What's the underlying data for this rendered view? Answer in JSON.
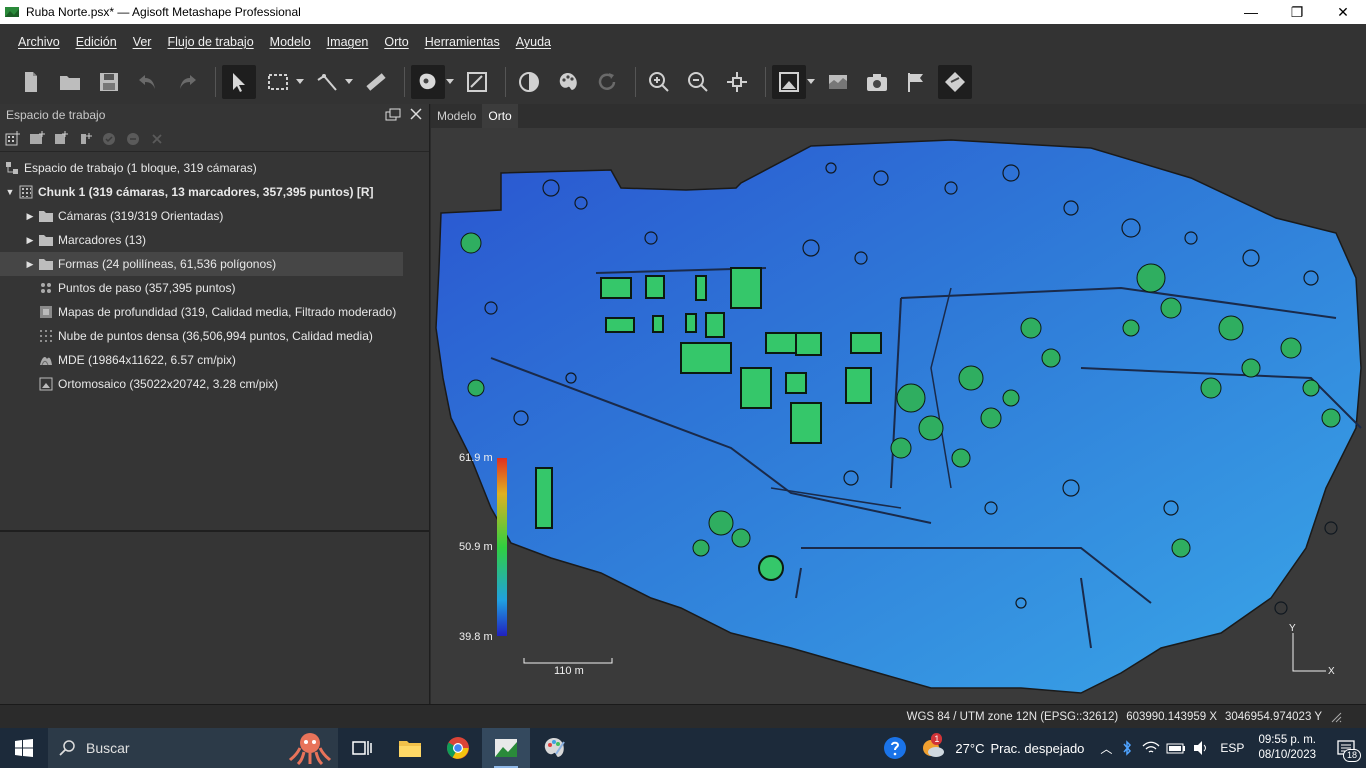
{
  "window": {
    "title": "Ruba Norte.psx* — Agisoft Metashape Professional",
    "minimize": "—",
    "restore": "❐",
    "close": "✕"
  },
  "menu": [
    "Archivo",
    "Edición",
    "Ver",
    "Flujo de trabajo",
    "Modelo",
    "Imagen",
    "Orto",
    "Herramientas",
    "Ayuda"
  ],
  "workspace": {
    "header": "Espacio de trabajo",
    "tree": [
      {
        "label": "Espacio de trabajo (1 bloque, 319 cámaras)",
        "icon": "workspace-icon"
      },
      {
        "label": "Chunk 1 (319 cámaras, 13 marcadores, 357,395 puntos) [R]",
        "icon": "chunk-icon"
      },
      {
        "label": "Cámaras (319/319 Orientadas)",
        "icon": "folder-icon"
      },
      {
        "label": "Marcadores (13)",
        "icon": "folder-icon"
      },
      {
        "label": "Formas (24 polilíneas, 61,536 polígonos)",
        "icon": "folder-icon"
      },
      {
        "label": "Puntos de paso (357,395 puntos)",
        "icon": "tie-points-icon"
      },
      {
        "label": "Mapas de profundidad (319, Calidad media, Filtrado moderado)",
        "icon": "depth-maps-icon"
      },
      {
        "label": "Nube de puntos densa (36,506,994 puntos, Calidad media)",
        "icon": "dense-cloud-icon"
      },
      {
        "label": "MDE (19864x11622, 6.57 cm/pix)",
        "icon": "dem-icon"
      },
      {
        "label": "Ortomosaico (35022x20742, 3.28 cm/pix)",
        "icon": "orthomosaic-icon"
      }
    ]
  },
  "tabs": [
    "Modelo",
    "Orto"
  ],
  "legend": {
    "max": "61.9 m",
    "mid": "50.9 m",
    "min": "39.8 m"
  },
  "scalebar": "110 m",
  "axes": {
    "y": "Y",
    "x": "X"
  },
  "status": {
    "crs": "WGS 84 / UTM zone 12N (EPSG::32612)",
    "x": "603990.143959 X",
    "y": "3046954.974023 Y"
  },
  "taskbar": {
    "search_placeholder": "Buscar",
    "weather_badge": "1",
    "temperature": "27°C",
    "weather": "Prac. despejado",
    "lang": "ESP",
    "time": "09:55 p. m.",
    "date": "08/10/2023",
    "notifications": "18"
  },
  "colors": {
    "ramp_high": "#e03020",
    "ramp_mid": "#30d040",
    "ramp_low": "#2020c0",
    "terrain_blue": "#2f7bd8",
    "terrain_light": "#3aa7e8"
  }
}
